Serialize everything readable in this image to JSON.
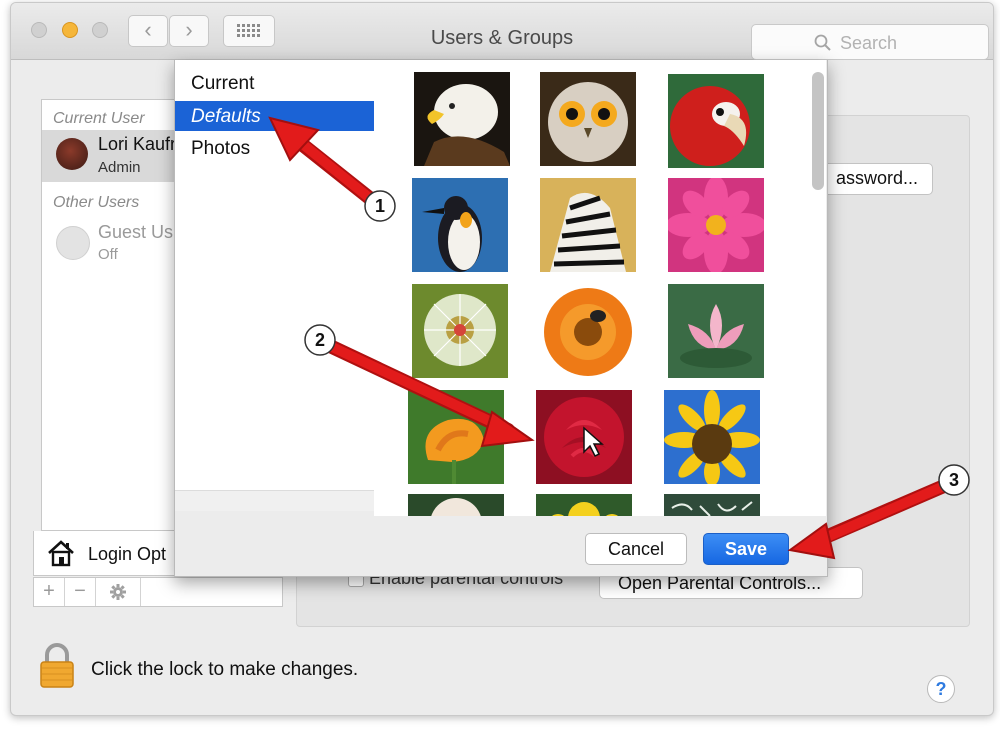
{
  "window": {
    "title": "Users & Groups"
  },
  "search": {
    "placeholder": "Search"
  },
  "userlist": {
    "current_header": "Current User",
    "current_user": {
      "name": "Lori Kaufr",
      "role": "Admin"
    },
    "other_header": "Other Users",
    "guest": {
      "name": "Guest Us",
      "status": "Off"
    },
    "login_options": "Login Opt",
    "add": "+",
    "remove": "−"
  },
  "right": {
    "password_button": "assword...",
    "parental_checkbox_label": "Enable parental controls",
    "open_parental_button": "Open Parental Controls..."
  },
  "picker": {
    "sources": [
      "Current",
      "Defaults",
      "Photos"
    ],
    "selected_source": "Defaults",
    "cancel": "Cancel",
    "save": "Save",
    "images": [
      "eagle",
      "owl",
      "parrot",
      "penguin",
      "zebra",
      "pink-flower",
      "dandelion",
      "orange-flower",
      "lotus",
      "poppy",
      "red-rose",
      "sunflower",
      "white-flower",
      "yellow-flowers",
      "chalkboard"
    ]
  },
  "footer": {
    "lock_text": "Click the lock to make changes.",
    "help": "?"
  },
  "annotations": [
    "1",
    "2",
    "3"
  ],
  "colors": {
    "selection": "#1b63d6",
    "save": "#1667e2",
    "arrow": "#e21b1b",
    "lock": "#f0a830"
  }
}
